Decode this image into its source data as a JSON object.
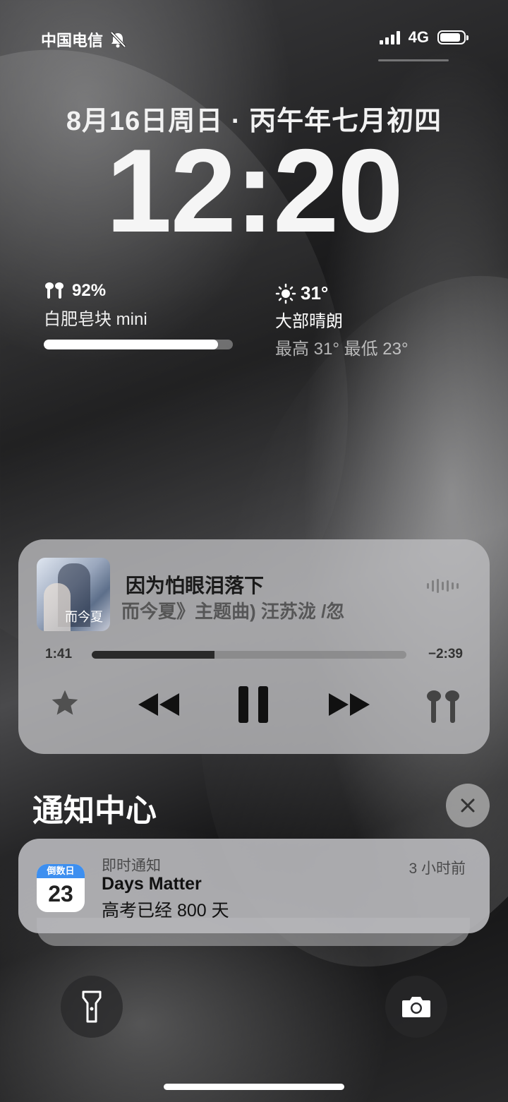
{
  "status_bar": {
    "carrier": "中国电信",
    "network": "4G",
    "icons": [
      "bell-slash-icon",
      "signal-icon",
      "battery-icon"
    ]
  },
  "lock_screen": {
    "date": "8月16日周日 · 丙午年七月初四",
    "time": "12:20"
  },
  "battery_widget": {
    "icon": "airpods-icon",
    "percent": "92%",
    "device_name": "白肥皂块 mini",
    "level": 0.92
  },
  "weather_widget": {
    "icon": "sun-icon",
    "temperature": "31°",
    "condition": "大部晴朗",
    "range": "最高 31° 最低 23°"
  },
  "now_playing": {
    "album_art_text": "而今夏",
    "title": "因为怕眼泪落下",
    "subtitle": "而今夏》主题曲)      汪苏泷 /忽",
    "elapsed": "1:41",
    "remaining": "−2:39",
    "progress": 0.39,
    "controls": [
      "star-icon",
      "rewind-icon",
      "pause-icon",
      "fast-forward-icon",
      "airpods-icon"
    ]
  },
  "notification_center": {
    "title": "通知中心"
  },
  "notification": {
    "icon_header": "倒数日",
    "icon_number": "23",
    "kind": "即时通知",
    "time_ago": "3 小时前",
    "app": "Days Matter",
    "body": "高考已经 800 天"
  },
  "quick_actions": [
    "flashlight-icon",
    "camera-icon"
  ]
}
